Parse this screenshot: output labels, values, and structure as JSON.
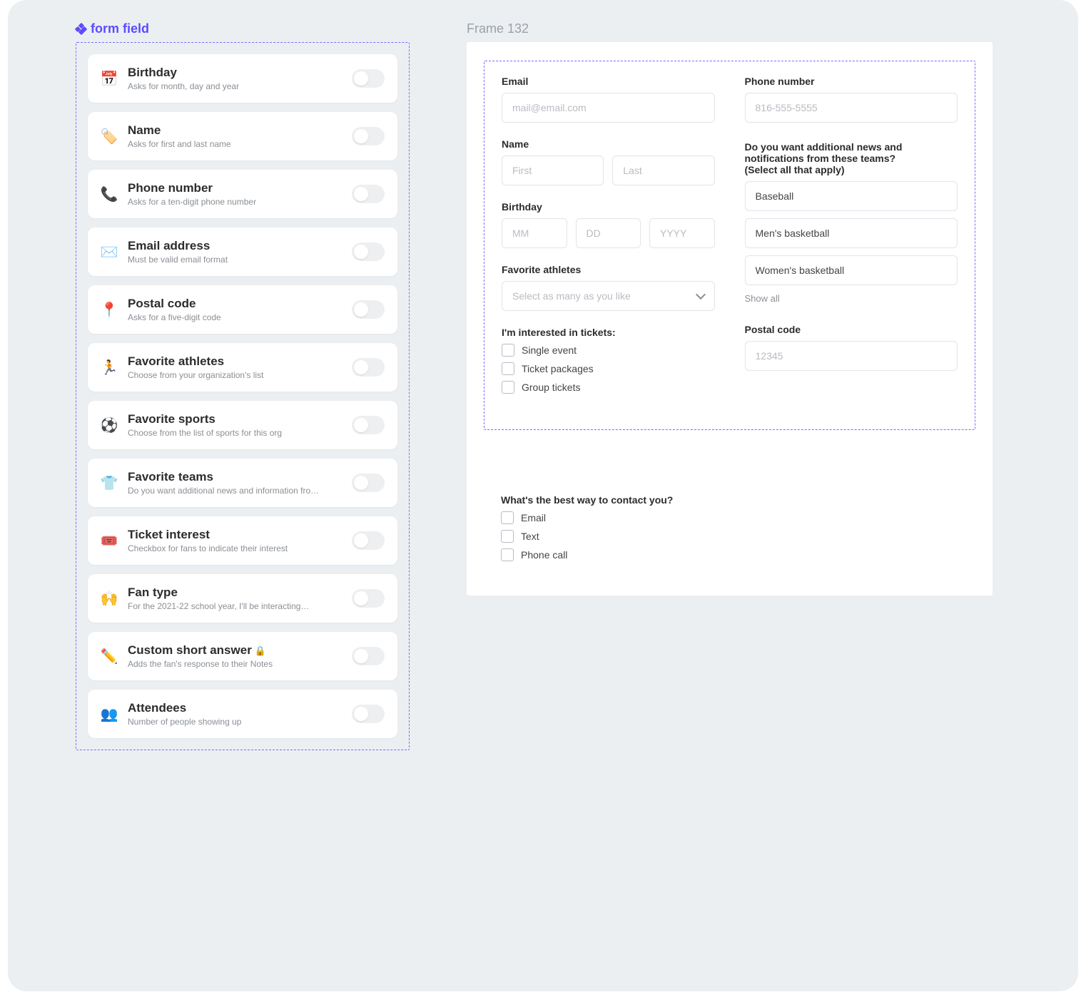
{
  "left_panel": {
    "label": "form field",
    "fields": [
      {
        "icon": "📅",
        "title": "Birthday",
        "sub": "Asks for month, day and year",
        "name": "birthday"
      },
      {
        "icon": "🏷️",
        "title": "Name",
        "sub": "Asks for first and last name",
        "name": "name"
      },
      {
        "icon": "📞",
        "title": "Phone number",
        "sub": "Asks for a ten-digit phone number",
        "name": "phone-number"
      },
      {
        "icon": "✉️",
        "title": "Email address",
        "sub": "Must be valid email format",
        "name": "email-address"
      },
      {
        "icon": "📍",
        "title": "Postal code",
        "sub": "Asks for a five-digit code",
        "name": "postal-code"
      },
      {
        "icon": "🏃",
        "title": "Favorite athletes",
        "sub": "Choose from your organization's list",
        "name": "favorite-athletes"
      },
      {
        "icon": "⚽",
        "title": "Favorite sports",
        "sub": "Choose from the list of sports for this org",
        "name": "favorite-sports"
      },
      {
        "icon": "👕",
        "title": "Favorite teams",
        "sub": "Do you want additional news and information from…",
        "name": "favorite-teams"
      },
      {
        "icon": "🎟️",
        "title": "Ticket interest",
        "sub": "Checkbox for fans to indicate their interest",
        "name": "ticket-interest"
      },
      {
        "icon": "🙌",
        "title": "Fan type",
        "sub": "For the 2021-22 school year, I'll be interacting…",
        "name": "fan-type"
      },
      {
        "icon": "✏️",
        "title": "Custom short answer",
        "sub": "Adds the fan's response to their Notes",
        "name": "custom-short-answer",
        "locked": true
      },
      {
        "icon": "👥",
        "title": "Attendees",
        "sub": "Number of people showing up",
        "name": "attendees"
      }
    ]
  },
  "right_panel": {
    "frame_label": "Frame 132",
    "email": {
      "label": "Email",
      "placeholder": "mail@email.com"
    },
    "phone": {
      "label": "Phone number",
      "placeholder": "816-555-5555"
    },
    "name": {
      "label": "Name",
      "first_placeholder": "First",
      "last_placeholder": "Last"
    },
    "birthday": {
      "label": "Birthday",
      "mm": "MM",
      "dd": "DD",
      "yyyy": "YYYY"
    },
    "athletes": {
      "label": "Favorite athletes",
      "placeholder": "Select as many as you like"
    },
    "tickets": {
      "label": "I'm interested in tickets:",
      "options": [
        "Single event",
        "Ticket packages",
        "Group tickets"
      ]
    },
    "news": {
      "label": "Do you want additional news and notifications from these teams? (Select all that apply)",
      "items": [
        "Baseball",
        "Men's basketball",
        "Women's basketball"
      ],
      "show_all": "Show all"
    },
    "postal": {
      "label": "Postal code",
      "placeholder": "12345"
    },
    "contact": {
      "label": "What's the best way to contact you?",
      "options": [
        "Email",
        "Text",
        "Phone call"
      ]
    }
  }
}
